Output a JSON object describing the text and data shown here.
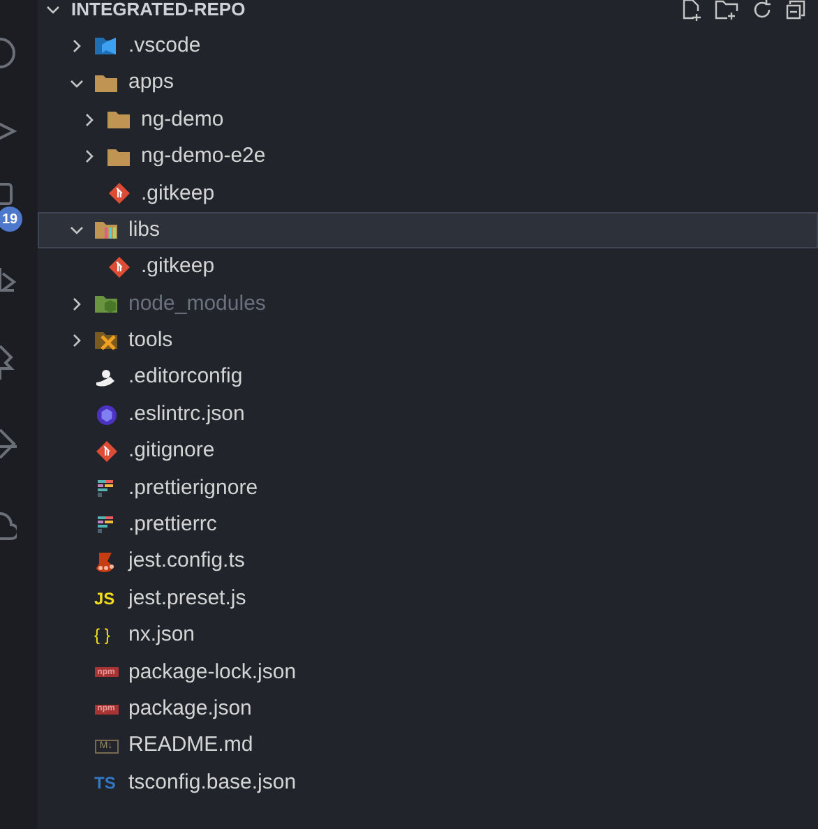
{
  "explorer": {
    "title": "INTEGRATED-REPO",
    "expanded": true
  },
  "activity_bar": {
    "badge": "19"
  },
  "tree": [
    {
      "name": ".vscode",
      "kind": "vscode-folder",
      "expanded": false,
      "selected": false,
      "ignored": false
    },
    {
      "name": "apps",
      "kind": "folder",
      "expanded": true,
      "selected": false,
      "ignored": false,
      "children": [
        {
          "name": "ng-demo",
          "kind": "folder",
          "expanded": false,
          "selected": false,
          "ignored": false
        },
        {
          "name": "ng-demo-e2e",
          "kind": "folder",
          "expanded": false,
          "selected": false,
          "ignored": false
        },
        {
          "name": ".gitkeep",
          "kind": "git",
          "selected": false,
          "ignored": false
        }
      ]
    },
    {
      "name": "libs",
      "kind": "libs-folder",
      "expanded": true,
      "selected": true,
      "ignored": false,
      "children": [
        {
          "name": ".gitkeep",
          "kind": "git",
          "selected": false,
          "ignored": false
        }
      ]
    },
    {
      "name": "node_modules",
      "kind": "node-folder",
      "expanded": false,
      "selected": false,
      "ignored": true
    },
    {
      "name": "tools",
      "kind": "tools-folder",
      "expanded": false,
      "selected": false,
      "ignored": false
    },
    {
      "name": ".editorconfig",
      "kind": "editorconfig",
      "selected": false,
      "ignored": false
    },
    {
      "name": ".eslintrc.json",
      "kind": "eslint",
      "selected": false,
      "ignored": false
    },
    {
      "name": ".gitignore",
      "kind": "git",
      "selected": false,
      "ignored": false
    },
    {
      "name": ".prettierignore",
      "kind": "prettier",
      "selected": false,
      "ignored": false
    },
    {
      "name": ".prettierrc",
      "kind": "prettier",
      "selected": false,
      "ignored": false
    },
    {
      "name": "jest.config.ts",
      "kind": "jest",
      "selected": false,
      "ignored": false
    },
    {
      "name": "jest.preset.js",
      "kind": "js",
      "glyph": "JS",
      "selected": false,
      "ignored": false
    },
    {
      "name": "nx.json",
      "kind": "json",
      "glyph": "{ }",
      "selected": false,
      "ignored": false
    },
    {
      "name": "package-lock.json",
      "kind": "npm",
      "glyph": "npm",
      "selected": false,
      "ignored": false
    },
    {
      "name": "package.json",
      "kind": "npm",
      "glyph": "npm",
      "selected": false,
      "ignored": false
    },
    {
      "name": "README.md",
      "kind": "markdown",
      "glyph": "M↓",
      "selected": false,
      "ignored": false
    },
    {
      "name": "tsconfig.base.json",
      "kind": "ts",
      "glyph": "TS",
      "selected": false,
      "ignored": false
    }
  ]
}
